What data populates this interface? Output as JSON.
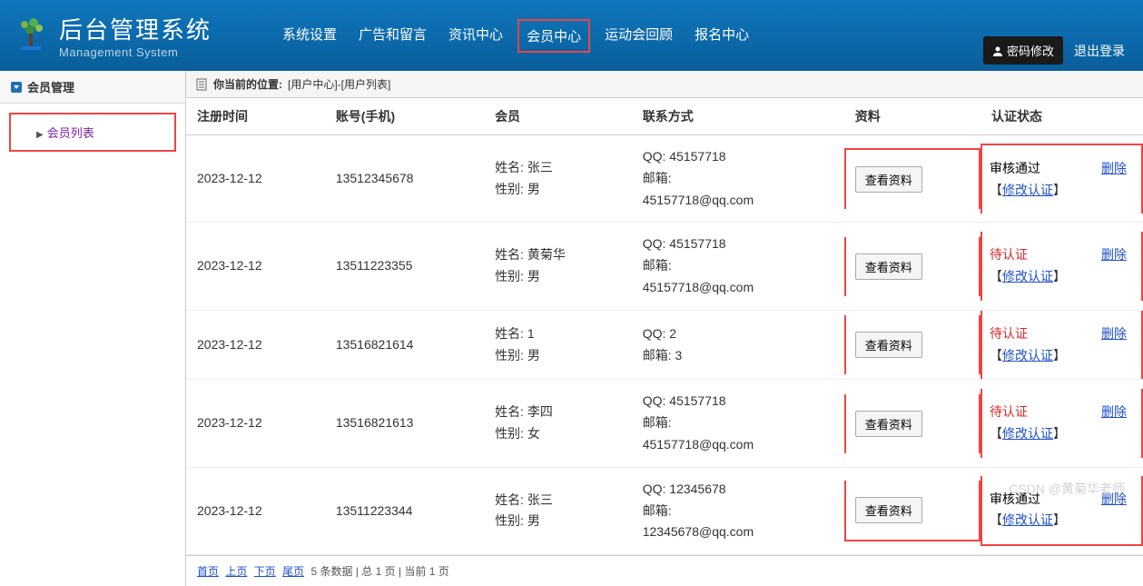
{
  "header": {
    "title_cn": "后台管理系统",
    "title_en": "Management System",
    "nav": [
      "系统设置",
      "广告和留言",
      "资讯中心",
      "会员中心",
      "运动会回顾",
      "报名中心"
    ],
    "nav_highlight_index": 3,
    "btn_password": "密码修改",
    "btn_logout": "退出登录"
  },
  "sidebar": {
    "title": "会员管理",
    "items": [
      {
        "label": "会员列表",
        "highlighted": true
      }
    ]
  },
  "breadcrumb": {
    "prefix": "你当前的位置:",
    "path": "[用户中心]-[用户列表]"
  },
  "table": {
    "headers": [
      "注册时间",
      "账号(手机)",
      "会员",
      "联系方式",
      "资料",
      "认证状态"
    ],
    "name_label": "姓名:",
    "gender_label": "性别:",
    "qq_label": "QQ:",
    "email_label": "邮箱:",
    "view_label": "查看资料",
    "modify_auth_label": "修改认证",
    "delete_label": "删除",
    "status_passed": "审核通过",
    "status_pending": "待认证",
    "rows": [
      {
        "date": "2023-12-12",
        "account": "13512345678",
        "name": "张三",
        "gender": "男",
        "qq": "45157718",
        "email": "45157718@qq.com",
        "status": "passed"
      },
      {
        "date": "2023-12-12",
        "account": "13511223355",
        "name": "黄菊华",
        "gender": "男",
        "qq": "45157718",
        "email": "45157718@qq.com",
        "status": "pending"
      },
      {
        "date": "2023-12-12",
        "account": "13516821614",
        "name": "1",
        "gender": "男",
        "qq": "2",
        "email": "3",
        "status": "pending"
      },
      {
        "date": "2023-12-12",
        "account": "13516821613",
        "name": "李四",
        "gender": "女",
        "qq": "45157718",
        "email": "45157718@qq.com",
        "status": "pending"
      },
      {
        "date": "2023-12-12",
        "account": "13511223344",
        "name": "张三",
        "gender": "男",
        "qq": "12345678",
        "email": "12345678@qq.com",
        "status": "passed"
      }
    ]
  },
  "pager": {
    "first": "首页",
    "prev": "上页",
    "next": "下页",
    "last": "尾页",
    "info": "5 条数据 | 总 1 页 | 当前 1 页"
  },
  "watermark": "CSDN @黄菊华老师"
}
